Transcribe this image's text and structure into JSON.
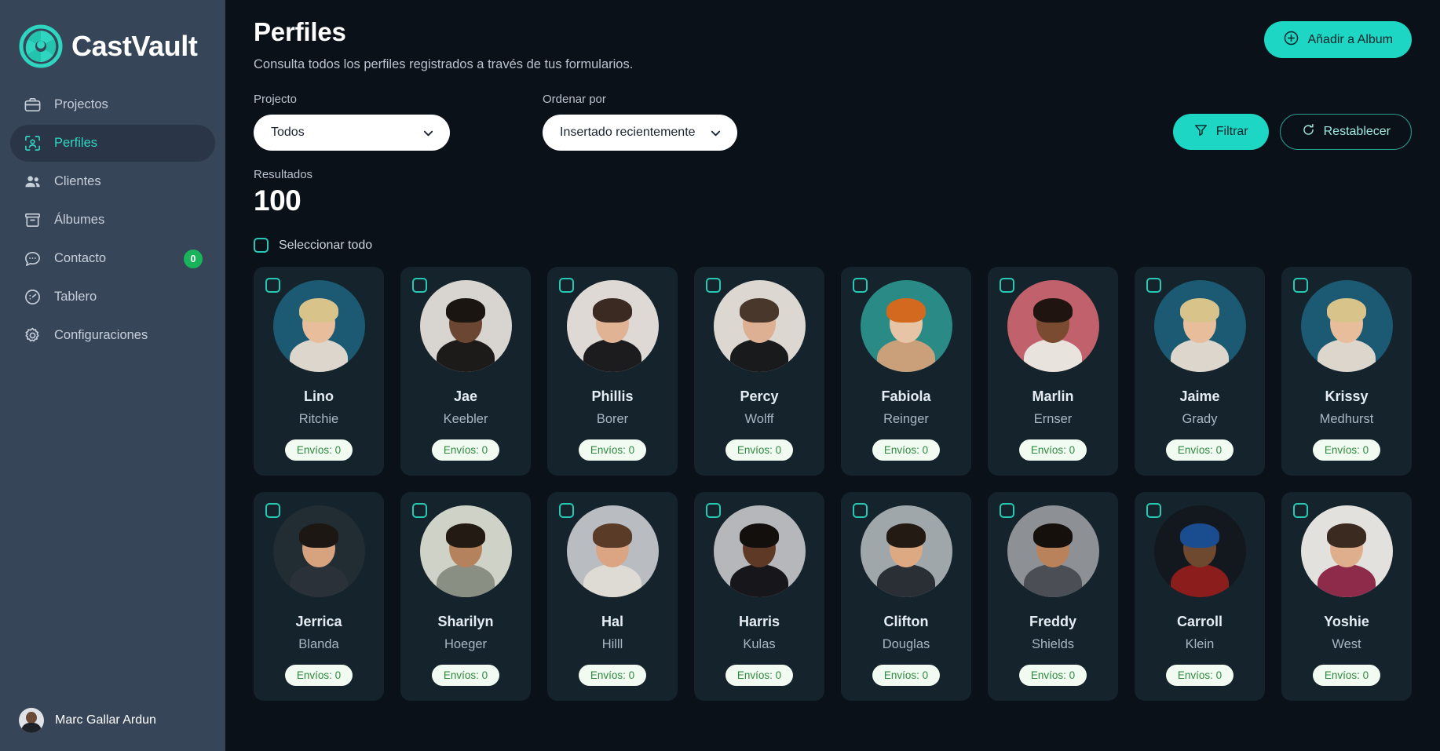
{
  "brand": {
    "name": "CastVault",
    "logo_icon": "aperture-logo-icon"
  },
  "sidebar": {
    "items": [
      {
        "label": "Projectos",
        "icon": "briefcase-icon",
        "active": false,
        "badge": null
      },
      {
        "label": "Perfiles",
        "icon": "profile-frame-icon",
        "active": true,
        "badge": null
      },
      {
        "label": "Clientes",
        "icon": "users-icon",
        "active": false,
        "badge": null
      },
      {
        "label": "Álbumes",
        "icon": "archive-box-icon",
        "active": false,
        "badge": null
      },
      {
        "label": "Contacto",
        "icon": "chat-bubble-icon",
        "active": false,
        "badge": "0"
      },
      {
        "label": "Tablero",
        "icon": "dashboard-gauge-icon",
        "active": false,
        "badge": null
      },
      {
        "label": "Configuraciones",
        "icon": "gear-icon",
        "active": false,
        "badge": null
      }
    ],
    "user": {
      "name": "Marc Gallar Ardun",
      "avatar_icon": "user-avatar"
    }
  },
  "header": {
    "title": "Perfiles",
    "subtitle": "Consulta todos los perfiles registrados a través de tus formularios.",
    "add_button": {
      "label": "Añadir a Album",
      "icon": "plus-circle-icon"
    }
  },
  "controls": {
    "project": {
      "label": "Projecto",
      "value": "Todos",
      "icon": "chevron-down-icon"
    },
    "sort": {
      "label": "Ordenar por",
      "value": "Insertado recientemente",
      "icon": "chevron-down-icon"
    },
    "filter_button": {
      "label": "Filtrar",
      "icon": "funnel-icon"
    },
    "reset_button": {
      "label": "Restablecer",
      "icon": "refresh-icon"
    }
  },
  "results": {
    "label": "Resultados",
    "value": "100"
  },
  "select_all": {
    "label": "Seleccionar todo",
    "checked": false
  },
  "colors": {
    "accent": "#1ed6c4",
    "sidebar_bg": "#374558",
    "sidebar_active_bg": "#2a3547",
    "main_bg": "#0b1118",
    "card_bg": "#15242c",
    "badge_green": "#18b35a",
    "pill_text": "#2d8a3e",
    "pill_bg": "#f2fbf2"
  },
  "profiles": [
    {
      "first": "Lino",
      "last": "Ritchie",
      "badge": "Envíos: 0",
      "bg": "#1b5a72",
      "skin": "#e7bd9b",
      "hair": "#d8c38a",
      "shirt": "#ddd6cc"
    },
    {
      "first": "Jae",
      "last": "Keebler",
      "badge": "Envíos: 0",
      "bg": "#d8d5d0",
      "skin": "#6b4632",
      "hair": "#1b1512",
      "shirt": "#1d1b1a"
    },
    {
      "first": "Phillis",
      "last": "Borer",
      "badge": "Envíos: 0",
      "bg": "#ded9d4",
      "skin": "#e0b395",
      "hair": "#3a2a21",
      "shirt": "#1c1c1e"
    },
    {
      "first": "Percy",
      "last": "Wolff",
      "badge": "Envíos: 0",
      "bg": "#dcd7d1",
      "skin": "#ddb093",
      "hair": "#4a372c",
      "shirt": "#191a1c"
    },
    {
      "first": "Fabiola",
      "last": "Reinger",
      "badge": "Envíos: 0",
      "bg": "#2a8b86",
      "skin": "#e8c4a6",
      "hair": "#d2691e",
      "shirt": "#caa07a"
    },
    {
      "first": "Marlin",
      "last": "Ernser",
      "badge": "Envíos: 0",
      "bg": "#c0616b",
      "skin": "#7a4b31",
      "hair": "#201410",
      "shirt": "#e8e3dd"
    },
    {
      "first": "Jaime",
      "last": "Grady",
      "badge": "Envíos: 0",
      "bg": "#1b5a72",
      "skin": "#e7bd9b",
      "hair": "#d8c38a",
      "shirt": "#ddd6cc"
    },
    {
      "first": "Krissy",
      "last": "Medhurst",
      "badge": "Envíos: 0",
      "bg": "#1b5a72",
      "skin": "#e7bd9b",
      "hair": "#d8c38a",
      "shirt": "#ddd6cc"
    },
    {
      "first": "Jerrica",
      "last": "Blanda",
      "badge": "Envíos: 0",
      "bg": "#222c33",
      "skin": "#d6a37e",
      "hair": "#1d1713",
      "shirt": "#2b3138"
    },
    {
      "first": "Sharilyn",
      "last": "Hoeger",
      "badge": "Envíos: 0",
      "bg": "#cfd3c7",
      "skin": "#b4835d",
      "hair": "#241a14",
      "shirt": "#8a8f84"
    },
    {
      "first": "Hal",
      "last": "Hilll",
      "badge": "Envíos: 0",
      "bg": "#b9bcc0",
      "skin": "#dba583",
      "hair": "#5a3b27",
      "shirt": "#dedad4"
    },
    {
      "first": "Harris",
      "last": "Kulas",
      "badge": "Envíos: 0",
      "bg": "#b5b7ba",
      "skin": "#5e3a26",
      "hair": "#130f0d",
      "shirt": "#17161a"
    },
    {
      "first": "Clifton",
      "last": "Douglas",
      "badge": "Envíos: 0",
      "bg": "#9fa7ab",
      "skin": "#dda983",
      "hair": "#241a14",
      "shirt": "#2a2f36"
    },
    {
      "first": "Freddy",
      "last": "Shields",
      "badge": "Envíos: 0",
      "bg": "#8d9196",
      "skin": "#b9825a",
      "hair": "#16100d",
      "shirt": "#4b4f55"
    },
    {
      "first": "Carroll",
      "last": "Klein",
      "badge": "Envíos: 0",
      "bg": "#12181e",
      "skin": "#6f4830",
      "hair": "#1a4d8f",
      "shirt": "#8b1d1d"
    },
    {
      "first": "Yoshie",
      "last": "West",
      "badge": "Envíos: 0",
      "bg": "#e3e1dd",
      "skin": "#dfae8c",
      "hair": "#3b2a20",
      "shirt": "#8e2b4a"
    }
  ]
}
